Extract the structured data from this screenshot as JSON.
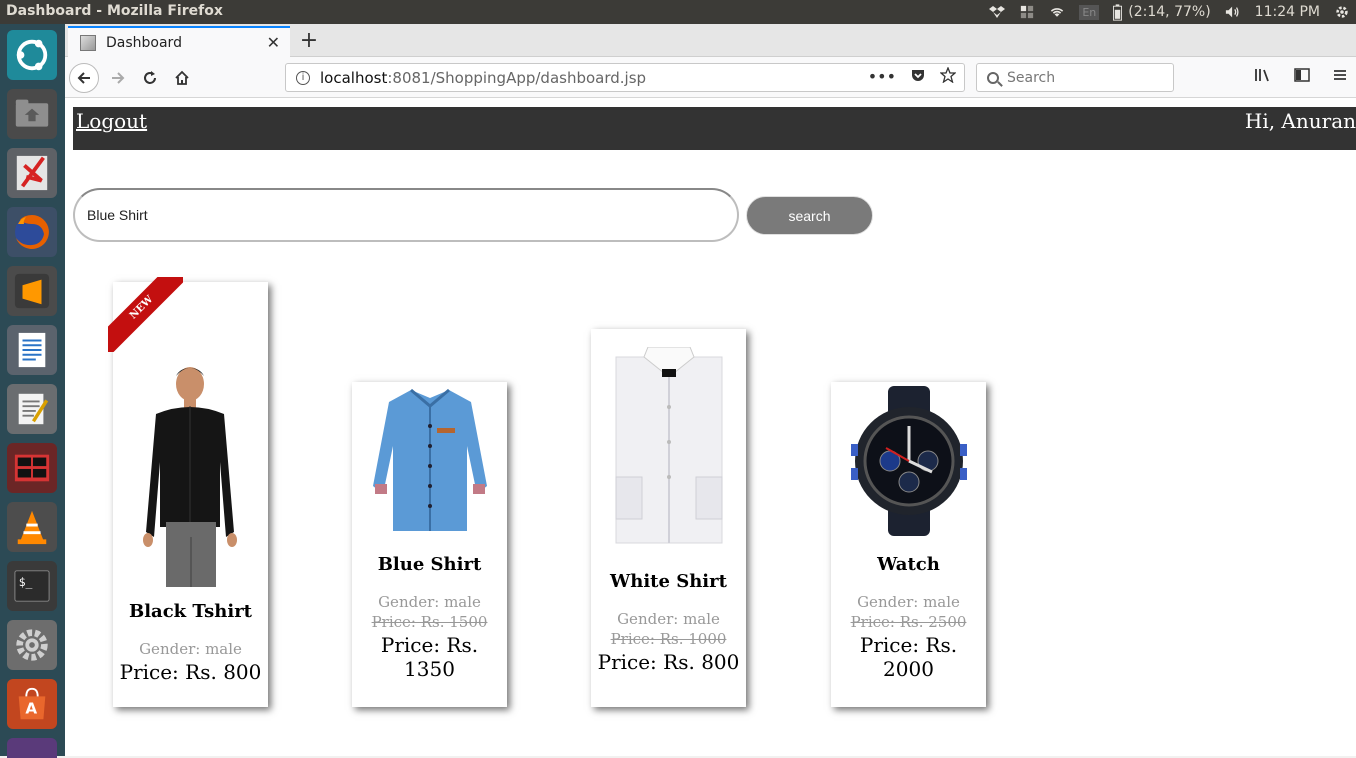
{
  "system": {
    "window_title": "Dashboard - Mozilla Firefox",
    "keyboard": "En",
    "battery": "(2:14, 77%)",
    "clock": "11:24 PM"
  },
  "browser": {
    "tab_label": "Dashboard",
    "url_host": "localhost",
    "url_path": ":8081/ShoppingApp/dashboard.jsp",
    "search_placeholder": "Search"
  },
  "header": {
    "logout_label": "Logout",
    "greeting": "Hi, Anuran"
  },
  "search": {
    "query": "Blue Shirt",
    "button_label": "search"
  },
  "products": [
    {
      "name": "Black Tshirt",
      "gender": "Gender: male",
      "old_price": "",
      "price": "Price: Rs. 800",
      "badge": "NEW",
      "image": "black-shirt"
    },
    {
      "name": "Blue Shirt",
      "gender": "Gender: male",
      "old_price": "Price: Rs. 1500",
      "price": "Price: Rs. 1350",
      "badge": "",
      "image": "blue-shirt"
    },
    {
      "name": "White Shirt",
      "gender": "Gender: male",
      "old_price": "Price: Rs. 1000",
      "price": "Price: Rs. 800",
      "badge": "",
      "image": "white-shirt"
    },
    {
      "name": "Watch",
      "gender": "Gender: male",
      "old_price": "Price: Rs. 2500",
      "price": "Price: Rs. 2000",
      "badge": "",
      "image": "watch"
    }
  ],
  "colors": {
    "header_bg": "#333333",
    "button_bg": "#7a7a7a",
    "badge_red": "#c30f0f"
  }
}
